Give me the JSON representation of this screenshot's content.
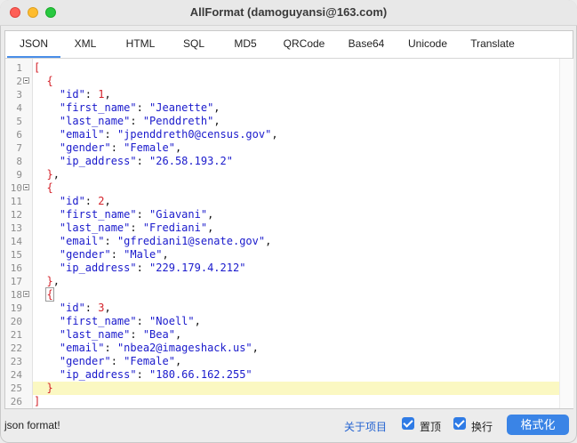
{
  "window": {
    "title": "AllFormat (damoguyansi@163.com)"
  },
  "tabs": [
    {
      "label": "JSON",
      "active": true
    },
    {
      "label": "XML"
    },
    {
      "label": "HTML"
    },
    {
      "label": "SQL"
    },
    {
      "label": "MD5"
    },
    {
      "label": "QRCode"
    },
    {
      "label": "Base64"
    },
    {
      "label": "Unicode"
    },
    {
      "label": "Translate"
    }
  ],
  "editor": {
    "highlight_line": 25,
    "lines": [
      {
        "n": "1",
        "fold": false,
        "tokens": [
          [
            "bracket",
            "["
          ]
        ]
      },
      {
        "n": "2",
        "fold": true,
        "tokens": [
          [
            "bracket",
            "  {"
          ]
        ]
      },
      {
        "n": "3",
        "fold": false,
        "tokens": [
          [
            "key",
            "    \"id\""
          ],
          [
            "punct",
            ": "
          ],
          [
            "num",
            "1"
          ],
          [
            "punct",
            ","
          ]
        ]
      },
      {
        "n": "4",
        "fold": false,
        "tokens": [
          [
            "key",
            "    \"first_name\""
          ],
          [
            "punct",
            ": "
          ],
          [
            "str",
            "\"Jeanette\""
          ],
          [
            "punct",
            ","
          ]
        ]
      },
      {
        "n": "5",
        "fold": false,
        "tokens": [
          [
            "key",
            "    \"last_name\""
          ],
          [
            "punct",
            ": "
          ],
          [
            "str",
            "\"Penddreth\""
          ],
          [
            "punct",
            ","
          ]
        ]
      },
      {
        "n": "6",
        "fold": false,
        "tokens": [
          [
            "key",
            "    \"email\""
          ],
          [
            "punct",
            ": "
          ],
          [
            "str",
            "\"jpenddreth0@census.gov\""
          ],
          [
            "punct",
            ","
          ]
        ]
      },
      {
        "n": "7",
        "fold": false,
        "tokens": [
          [
            "key",
            "    \"gender\""
          ],
          [
            "punct",
            ": "
          ],
          [
            "str",
            "\"Female\""
          ],
          [
            "punct",
            ","
          ]
        ]
      },
      {
        "n": "8",
        "fold": false,
        "tokens": [
          [
            "key",
            "    \"ip_address\""
          ],
          [
            "punct",
            ": "
          ],
          [
            "str",
            "\"26.58.193.2\""
          ]
        ]
      },
      {
        "n": "9",
        "fold": false,
        "tokens": [
          [
            "bracket",
            "  }"
          ],
          [
            "punct",
            ","
          ]
        ]
      },
      {
        "n": "10",
        "fold": true,
        "tokens": [
          [
            "bracket",
            "  {"
          ]
        ]
      },
      {
        "n": "11",
        "fold": false,
        "tokens": [
          [
            "key",
            "    \"id\""
          ],
          [
            "punct",
            ": "
          ],
          [
            "num",
            "2"
          ],
          [
            "punct",
            ","
          ]
        ]
      },
      {
        "n": "12",
        "fold": false,
        "tokens": [
          [
            "key",
            "    \"first_name\""
          ],
          [
            "punct",
            ": "
          ],
          [
            "str",
            "\"Giavani\""
          ],
          [
            "punct",
            ","
          ]
        ]
      },
      {
        "n": "13",
        "fold": false,
        "tokens": [
          [
            "key",
            "    \"last_name\""
          ],
          [
            "punct",
            ": "
          ],
          [
            "str",
            "\"Frediani\""
          ],
          [
            "punct",
            ","
          ]
        ]
      },
      {
        "n": "14",
        "fold": false,
        "tokens": [
          [
            "key",
            "    \"email\""
          ],
          [
            "punct",
            ": "
          ],
          [
            "str",
            "\"gfrediani1@senate.gov\""
          ],
          [
            "punct",
            ","
          ]
        ]
      },
      {
        "n": "15",
        "fold": false,
        "tokens": [
          [
            "key",
            "    \"gender\""
          ],
          [
            "punct",
            ": "
          ],
          [
            "str",
            "\"Male\""
          ],
          [
            "punct",
            ","
          ]
        ]
      },
      {
        "n": "16",
        "fold": false,
        "tokens": [
          [
            "key",
            "    \"ip_address\""
          ],
          [
            "punct",
            ": "
          ],
          [
            "str",
            "\"229.179.4.212\""
          ]
        ]
      },
      {
        "n": "17",
        "fold": false,
        "tokens": [
          [
            "bracket",
            "  }"
          ],
          [
            "punct",
            ","
          ]
        ]
      },
      {
        "n": "18",
        "fold": true,
        "tokens": [
          [
            "bracket",
            "  "
          ],
          [
            "bracket-box",
            "{"
          ]
        ]
      },
      {
        "n": "19",
        "fold": false,
        "tokens": [
          [
            "key",
            "    \"id\""
          ],
          [
            "punct",
            ": "
          ],
          [
            "num",
            "3"
          ],
          [
            "punct",
            ","
          ]
        ]
      },
      {
        "n": "20",
        "fold": false,
        "tokens": [
          [
            "key",
            "    \"first_name\""
          ],
          [
            "punct",
            ": "
          ],
          [
            "str",
            "\"Noell\""
          ],
          [
            "punct",
            ","
          ]
        ]
      },
      {
        "n": "21",
        "fold": false,
        "tokens": [
          [
            "key",
            "    \"last_name\""
          ],
          [
            "punct",
            ": "
          ],
          [
            "str",
            "\"Bea\""
          ],
          [
            "punct",
            ","
          ]
        ]
      },
      {
        "n": "22",
        "fold": false,
        "tokens": [
          [
            "key",
            "    \"email\""
          ],
          [
            "punct",
            ": "
          ],
          [
            "str",
            "\"nbea2@imageshack.us\""
          ],
          [
            "punct",
            ","
          ]
        ]
      },
      {
        "n": "23",
        "fold": false,
        "tokens": [
          [
            "key",
            "    \"gender\""
          ],
          [
            "punct",
            ": "
          ],
          [
            "str",
            "\"Female\""
          ],
          [
            "punct",
            ","
          ]
        ]
      },
      {
        "n": "24",
        "fold": false,
        "tokens": [
          [
            "key",
            "    \"ip_address\""
          ],
          [
            "punct",
            ": "
          ],
          [
            "str",
            "\"180.66.162.255\""
          ]
        ]
      },
      {
        "n": "25",
        "fold": false,
        "tokens": [
          [
            "bracket",
            "  }"
          ]
        ]
      },
      {
        "n": "26",
        "fold": false,
        "tokens": [
          [
            "bracket",
            "]"
          ]
        ]
      }
    ]
  },
  "footer": {
    "status": "json format!",
    "about_label": "关于项目",
    "pin_top_label": "置顶",
    "pin_top_checked": true,
    "wrap_label": "换行",
    "wrap_checked": true,
    "format_button": "格式化"
  },
  "colors": {
    "accent": "#3a84e6",
    "link": "#2463d1",
    "bracket": "#d4222a",
    "string": "#1a1acc",
    "highlight": "#fbf8c2"
  }
}
